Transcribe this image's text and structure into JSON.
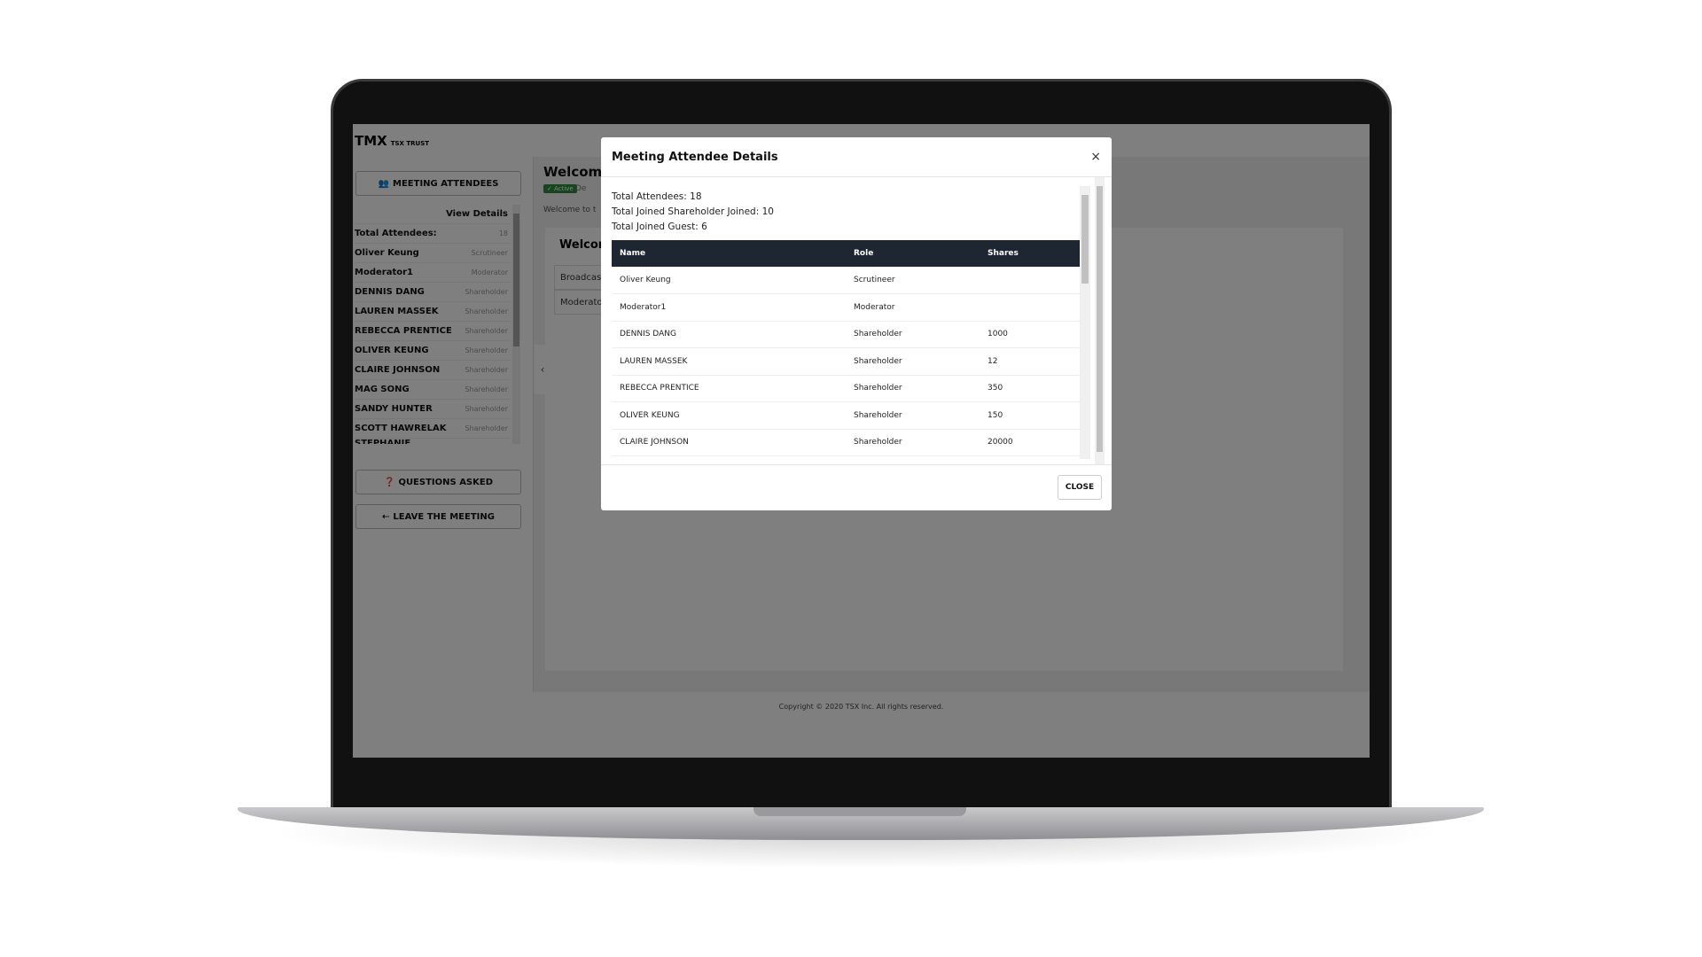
{
  "app": {
    "logo_text": "TMX",
    "logo_sub": "TSX TRUST"
  },
  "sidebar": {
    "attendees_button": "MEETING ATTENDEES",
    "view_details": "View Details",
    "rows": [
      {
        "name": "Total Attendees:",
        "value": "18"
      },
      {
        "name": "Oliver Keung",
        "value": "Scrutineer"
      },
      {
        "name": "Moderator1",
        "value": "Moderator"
      },
      {
        "name": "DENNIS DANG",
        "value": "Shareholder"
      },
      {
        "name": "LAUREN MASSEK",
        "value": "Shareholder"
      },
      {
        "name": "REBECCA PRENTICE",
        "value": "Shareholder"
      },
      {
        "name": "OLIVER KEUNG",
        "value": "Shareholder"
      },
      {
        "name": "CLAIRE JOHNSON",
        "value": "Shareholder"
      },
      {
        "name": "MAG SONG",
        "value": "Shareholder"
      },
      {
        "name": "SANDY HUNTER",
        "value": "Shareholder"
      },
      {
        "name": "SCOTT HAWRELAK",
        "value": "Shareholder"
      },
      {
        "name": "STEPHANIE LAFONTAINE",
        "value": "Shareholder"
      }
    ],
    "questions_button": "QUESTIONS ASKED",
    "leave_button": "LEAVE THE MEETING"
  },
  "main": {
    "title": "Welcome",
    "badge": "✓ Active",
    "badge_after": "De",
    "desc": "Welcome to t",
    "card_title": "Welcome",
    "items": [
      "Broadcast",
      "Moderator"
    ]
  },
  "footer": {
    "copyright": "Copyright © 2020 TSX Inc. All rights reserved."
  },
  "modal": {
    "title": "Meeting Attendee Details",
    "close_x": "×",
    "stats": [
      "Total Attendees: 18",
      "Total Joined Shareholder Joined: 10",
      "Total Joined Guest: 6"
    ],
    "columns": [
      "Name",
      "Role",
      "Shares"
    ],
    "rows": [
      [
        "Oliver Keung",
        "Scrutineer",
        ""
      ],
      [
        "Moderator1",
        "Moderator",
        ""
      ],
      [
        "DENNIS DANG",
        "Shareholder",
        "1000"
      ],
      [
        "LAUREN MASSEK",
        "Shareholder",
        "12"
      ],
      [
        "REBECCA PRENTICE",
        "Shareholder",
        "350"
      ],
      [
        "OLIVER KEUNG",
        "Shareholder",
        "150"
      ],
      [
        "CLAIRE JOHNSON",
        "Shareholder",
        "20000"
      ]
    ],
    "close_button": "CLOSE"
  },
  "colors": {
    "table_header": "#1e2631",
    "active_badge": "#2e8b3a"
  }
}
